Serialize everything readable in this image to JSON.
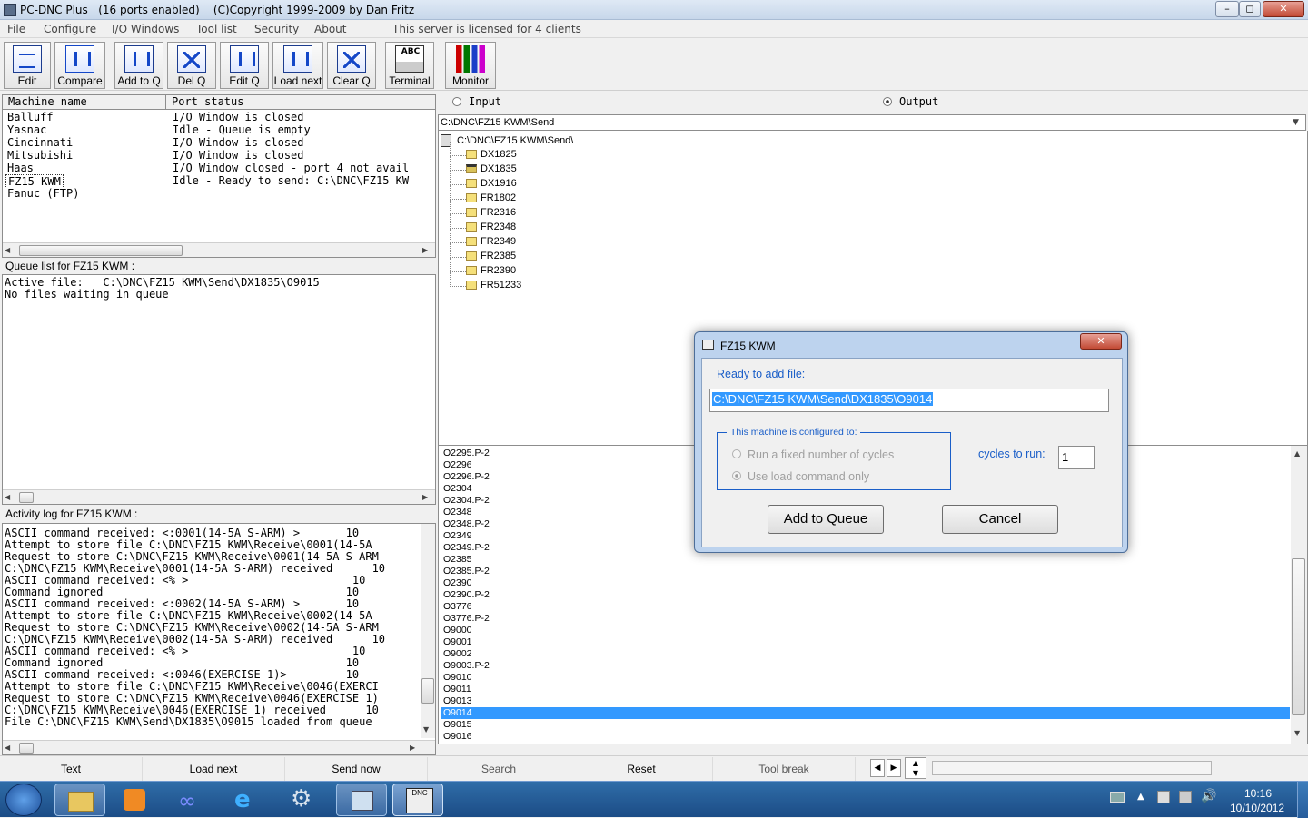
{
  "window": {
    "title": "PC-DNC Plus   (16 ports enabled)    (C)Copyright 1999-2009 by Dan Fritz",
    "minimize": "–",
    "maximize": "◻",
    "close": "✕"
  },
  "menu": {
    "items": [
      "File",
      "Configure",
      "I/O Windows",
      "Tool list",
      "Security",
      "About"
    ],
    "license": "This server is licensed for 4 clients"
  },
  "toolbar": {
    "buttons": [
      "Edit",
      "Compare",
      "Add to Q",
      "Del Q",
      "Edit Q",
      "Load next",
      "Clear Q",
      "Terminal",
      "Monitor"
    ]
  },
  "machines": {
    "col_name": "Machine name",
    "col_status": "Port status",
    "rows": [
      {
        "name": "Balluff",
        "status": "I/O Window is closed"
      },
      {
        "name": "Yasnac",
        "status": "Idle - Queue is empty"
      },
      {
        "name": "Cincinnati",
        "status": "I/O Window is closed"
      },
      {
        "name": "Mitsubishi",
        "status": "I/O Window is closed"
      },
      {
        "name": "Haas",
        "status": "I/O Window closed - port 4 not avail"
      },
      {
        "name": "FZ15 KWM",
        "status": "Idle - Ready to send: C:\\DNC\\FZ15 KW"
      },
      {
        "name": "Fanuc (FTP)",
        "status": ""
      }
    ]
  },
  "queue": {
    "label": "Queue list for FZ15 KWM :",
    "lines": [
      "Active file:   C:\\DNC\\FZ15 KWM\\Send\\DX1835\\O9015",
      "No files waiting in queue"
    ]
  },
  "activity": {
    "label": "Activity log for FZ15 KWM :",
    "lines": [
      "ASCII command received: <:0001(14-5A S-ARM) >       10",
      "Attempt to store file C:\\DNC\\FZ15 KWM\\Receive\\0001(14-5A",
      "Request to store C:\\DNC\\FZ15 KWM\\Receive\\0001(14-5A S-ARM",
      "C:\\DNC\\FZ15 KWM\\Receive\\0001(14-5A S-ARM) received      10",
      "ASCII command received: <% >                         10",
      "Command ignored                                     10",
      "ASCII command received: <:0002(14-5A S-ARM) >       10",
      "Attempt to store file C:\\DNC\\FZ15 KWM\\Receive\\0002(14-5A",
      "Request to store C:\\DNC\\FZ15 KWM\\Receive\\0002(14-5A S-ARM",
      "C:\\DNC\\FZ15 KWM\\Receive\\0002(14-5A S-ARM) received      10",
      "ASCII command received: <% >                         10",
      "Command ignored                                     10",
      "ASCII command received: <:0046(EXERCISE 1)>         10",
      "Attempt to store file C:\\DNC\\FZ15 KWM\\Receive\\0046(EXERCI",
      "Request to store C:\\DNC\\FZ15 KWM\\Receive\\0046(EXERCISE 1)",
      "C:\\DNC\\FZ15 KWM\\Receive\\0046(EXERCISE 1) received      10",
      "File C:\\DNC\\FZ15 KWM\\Send\\DX1835\\O9015 loaded from queue"
    ]
  },
  "io": {
    "input_label": "Input",
    "output_label": "Output",
    "path": "C:\\DNC\\FZ15 KWM\\Send",
    "tree_root": "C:\\DNC\\FZ15 KWM\\Send\\",
    "folders": [
      "DX1825",
      "DX1835",
      "DX1916",
      "FR1802",
      "FR2316",
      "FR2348",
      "FR2349",
      "FR2385",
      "FR2390",
      "FR51233"
    ],
    "selected_folder": "DX1835",
    "files": [
      "O2295.P-2",
      "O2296",
      "O2296.P-2",
      "O2304",
      "O2304.P-2",
      "O2348",
      "O2348.P-2",
      "O2349",
      "O2349.P-2",
      "O2385",
      "O2385.P-2",
      "O2390",
      "O2390.P-2",
      "O3776",
      "O3776.P-2",
      "O9000",
      "O9001",
      "O9002",
      "O9003.P-2",
      "O9010",
      "O9011",
      "O9013",
      "O9014",
      "O9015",
      "O9016"
    ],
    "selected_file": "O9014"
  },
  "dialog": {
    "title": "FZ15 KWM",
    "ready_label": "Ready to add file:",
    "file_path": "C:\\DNC\\FZ15 KWM\\Send\\DX1835\\O9014",
    "group_label": "This machine is configured to:",
    "option1": "Run a fixed number  of cycles",
    "option2": "Use load command only",
    "cycles_label": "cycles to run:",
    "cycles_value": "1",
    "add_button": "Add to Queue",
    "cancel_button": "Cancel",
    "close": "✕"
  },
  "bottom_buttons": [
    "Text",
    "Load next",
    "Send now",
    "Search",
    "Reset",
    "Tool break"
  ],
  "taskbar": {
    "time": "10:16",
    "date": "10/10/2012",
    "dnc_label": "DNC"
  },
  "colors": {
    "selection": "#3399ff",
    "dialog_link": "#1a5ec8",
    "taskbar": "#1c4c86"
  }
}
